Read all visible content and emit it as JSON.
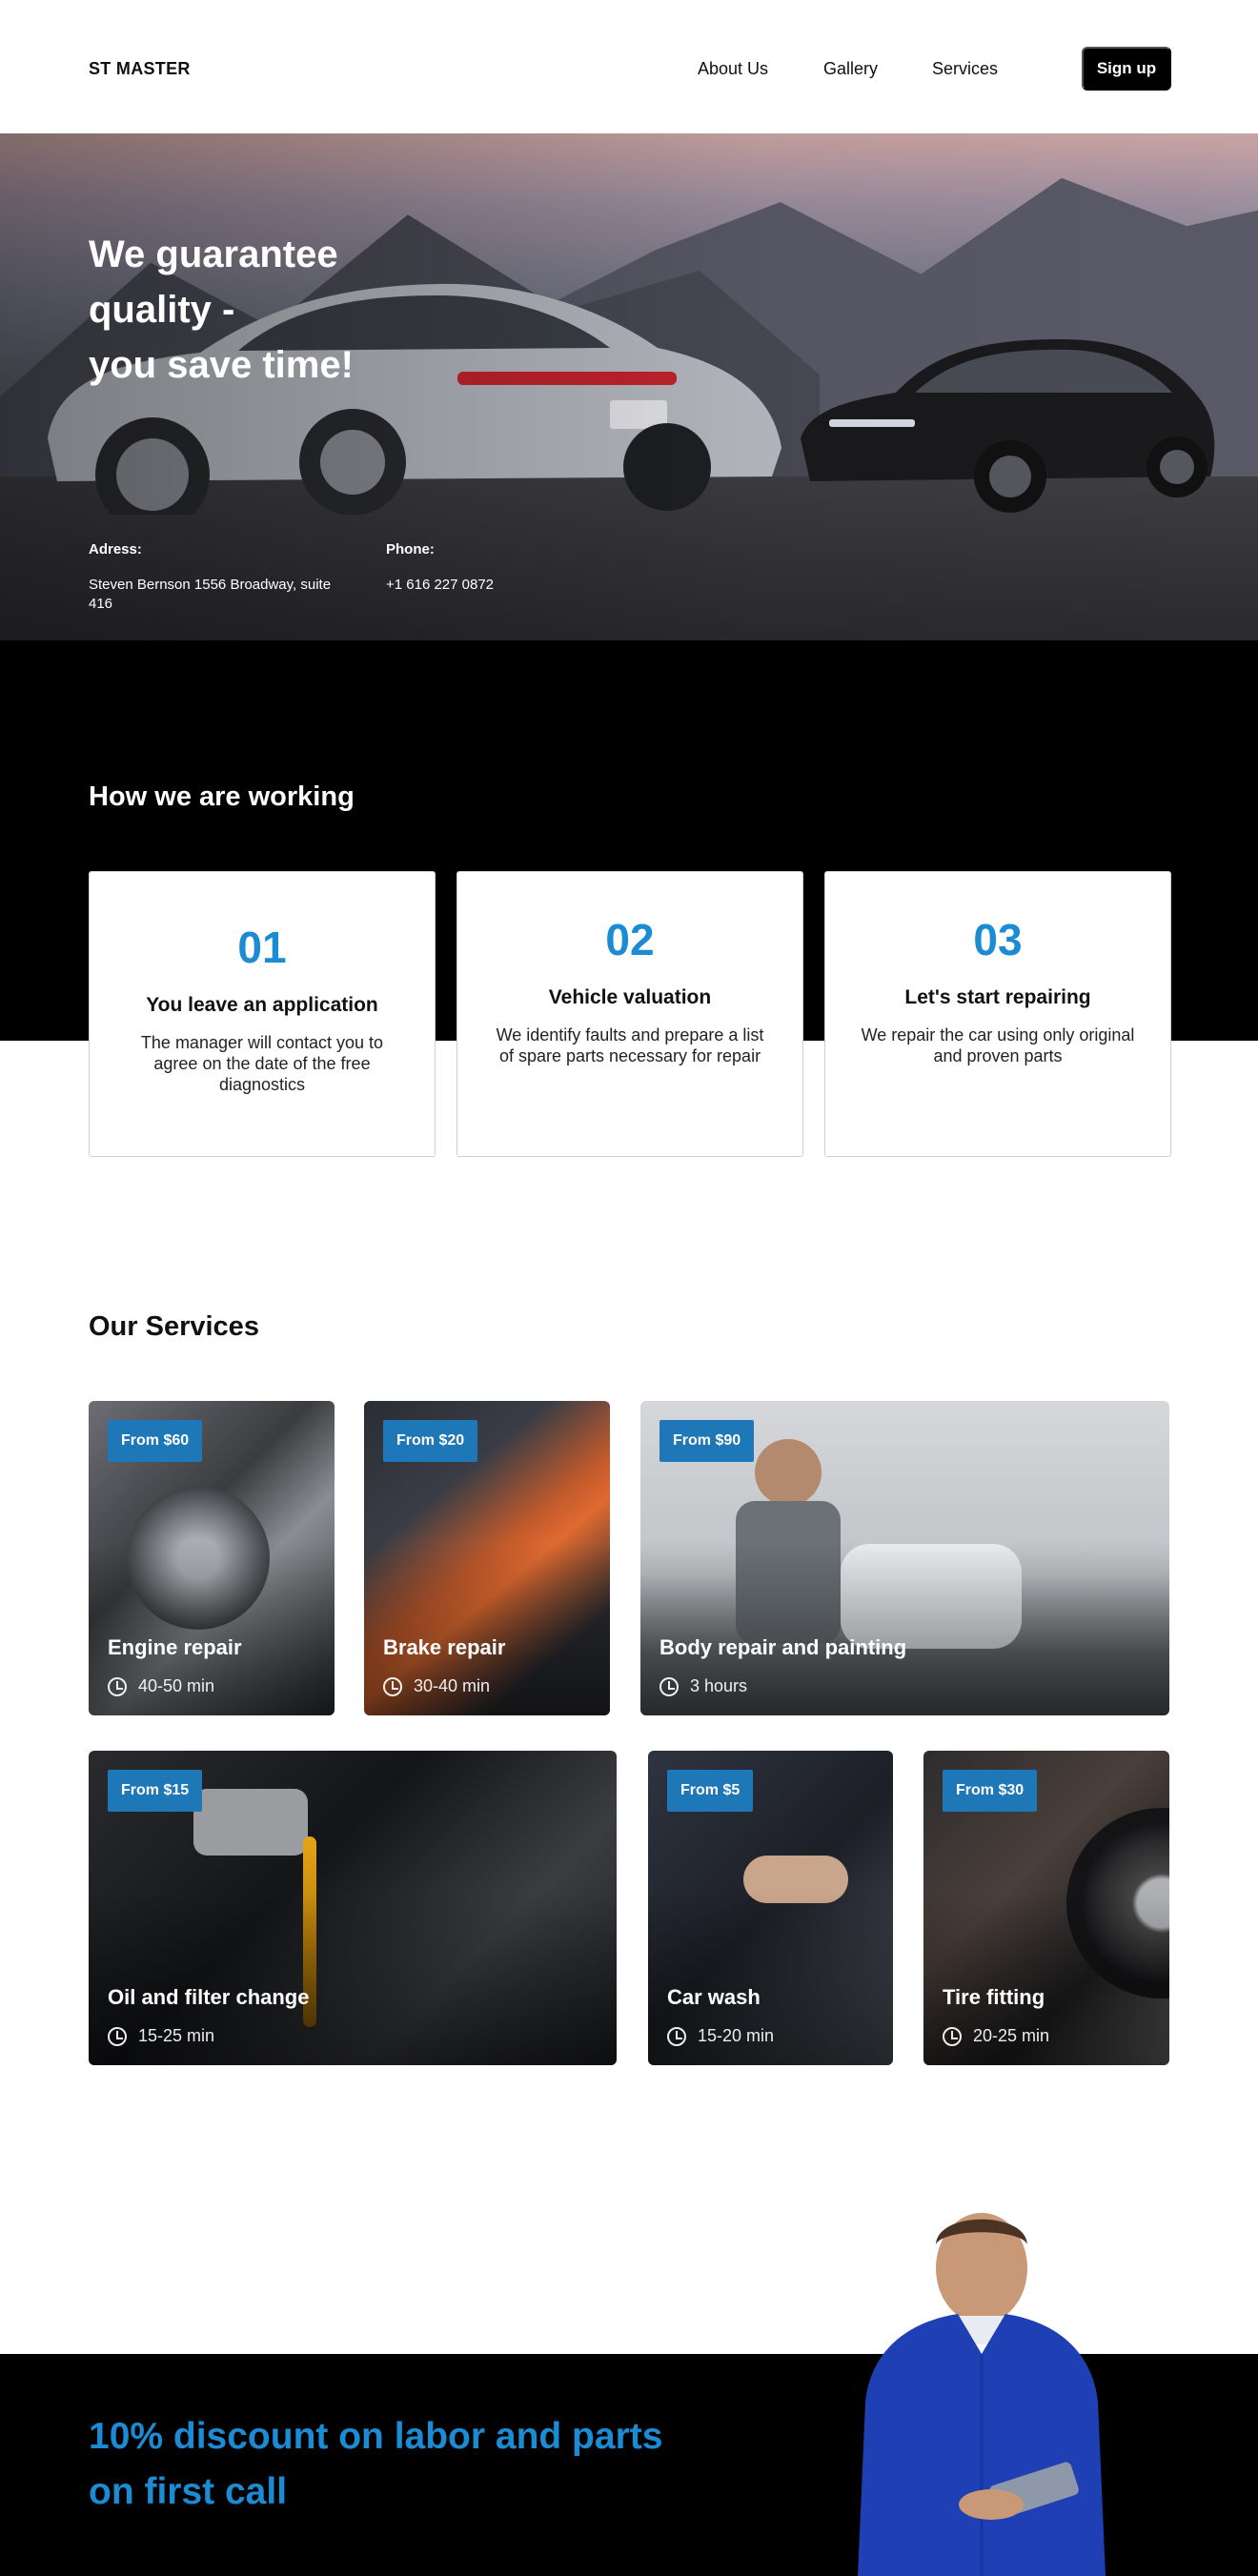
{
  "header": {
    "logo": "ST MASTER",
    "nav": [
      "About Us",
      "Gallery",
      "Services"
    ],
    "signup_label": "Sign up"
  },
  "hero": {
    "title_line1": "We guarantee",
    "title_line2": "quality -",
    "title_line3": "you save time!",
    "address_label": "Adress:",
    "address_value": "Steven Bernson 1556 Broadway, suite 416",
    "phone_label": "Phone:",
    "phone_value": "+1 616 227 0872"
  },
  "work": {
    "title": "How we are working",
    "steps": [
      {
        "num": "01",
        "title": "You leave an application",
        "text": "The manager will contact you to agree on the date of the free diagnostics"
      },
      {
        "num": "02",
        "title": "Vehicle valuation",
        "text": "We identify faults and prepare a list of spare parts necessary for repair"
      },
      {
        "num": "03",
        "title": "Let's start repairing",
        "text": "We repair the car using only original and proven parts"
      }
    ]
  },
  "services": {
    "title": "Our Services",
    "items": [
      {
        "price": "From $60",
        "title": "Engine repair",
        "time": "40-50 min"
      },
      {
        "price": "From $20",
        "title": "Brake repair",
        "time": "30-40 min"
      },
      {
        "price": "From $90",
        "title": "Body repair and painting",
        "time": "3 hours"
      },
      {
        "price": "From $15",
        "title": "Oil and filter change",
        "time": "15-25 min"
      },
      {
        "price": "From $5",
        "title": "Car wash",
        "time": "15-20 min"
      },
      {
        "price": "From $30",
        "title": "Tire fitting",
        "time": "20-25 min"
      }
    ]
  },
  "discount": {
    "line1": "10% discount on labor and parts",
    "line2": "on first call"
  },
  "colors": {
    "accent": "#1b8bd3",
    "price_badge": "#1e78b8",
    "dark": "#000000"
  }
}
